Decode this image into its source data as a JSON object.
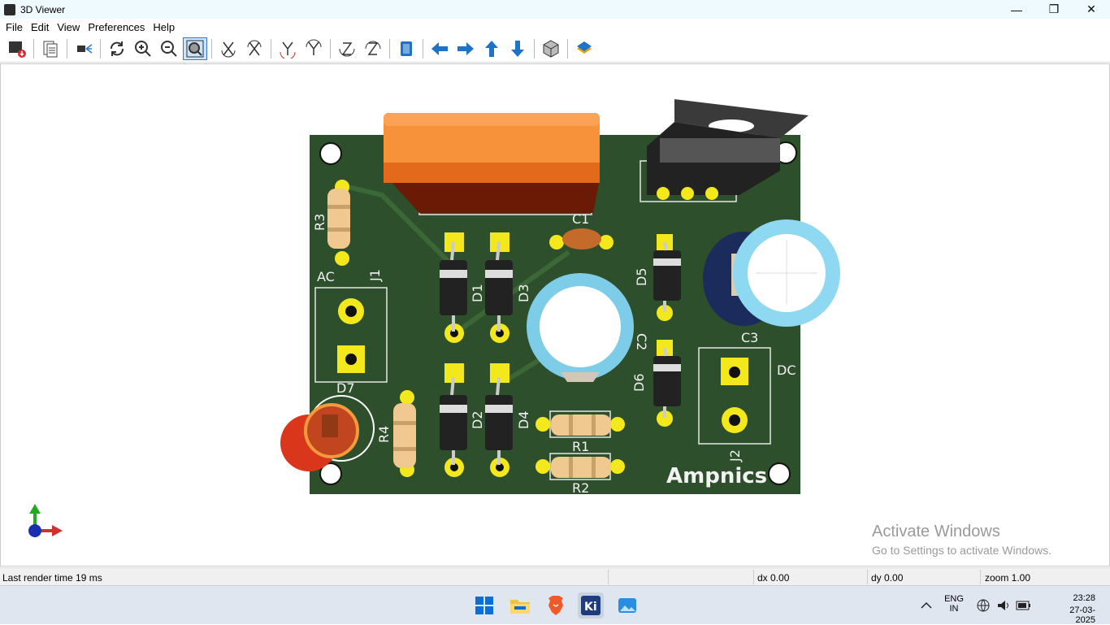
{
  "window": {
    "title": "3D Viewer",
    "minimize": "—",
    "maximize": "❐",
    "close": "✕"
  },
  "menu": [
    "File",
    "Edit",
    "View",
    "Preferences",
    "Help"
  ],
  "toolbar": {
    "buttons": [
      "export-icon",
      "copy-icon",
      "raytracing-icon",
      "reload-icon",
      "zoom-in-icon",
      "zoom-out-icon",
      "zoom-fit-icon",
      "rotate-x-cw-icon",
      "rotate-x-ccw-icon",
      "rotate-y-cw-icon",
      "rotate-y-ccw-icon",
      "rotate-z-cw-icon",
      "rotate-z-ccw-icon",
      "flip-board-icon",
      "pan-left-icon",
      "pan-right-icon",
      "pan-up-icon",
      "pan-down-icon",
      "ortho-icon",
      "layers-icon"
    ],
    "active": "zoom-fit-icon"
  },
  "pcb": {
    "labels": {
      "R3": "R3",
      "J1": "J1",
      "AC": "AC",
      "D7": "D7",
      "R4": "R4",
      "D1": "D1",
      "D2": "D2",
      "D3": "D3",
      "D4": "D4",
      "C1": "C1",
      "C2": "C2",
      "C3": "C3",
      "D5": "D5",
      "D6": "D6",
      "R1": "R1",
      "R2": "R2",
      "DC": "DC",
      "J2": "J2",
      "brand": "Ampnics"
    },
    "board_color": "#2e4f2b",
    "pad_color": "#f3e81b"
  },
  "status": {
    "render": "Last render time 19 ms",
    "dx": "dx 0.00",
    "dy": "dy 0.00",
    "zoom": "zoom 1.00"
  },
  "watermark": {
    "line1": "Activate Windows",
    "line2": "Go to Settings to activate Windows."
  },
  "taskbar": {
    "apps": [
      "windows-start-icon",
      "file-explorer-icon",
      "brave-browser-icon",
      "kicad-icon",
      "photos-icon"
    ],
    "lang": "ENG",
    "region": "IN",
    "time": "23:28",
    "date": "27-03-2025"
  }
}
